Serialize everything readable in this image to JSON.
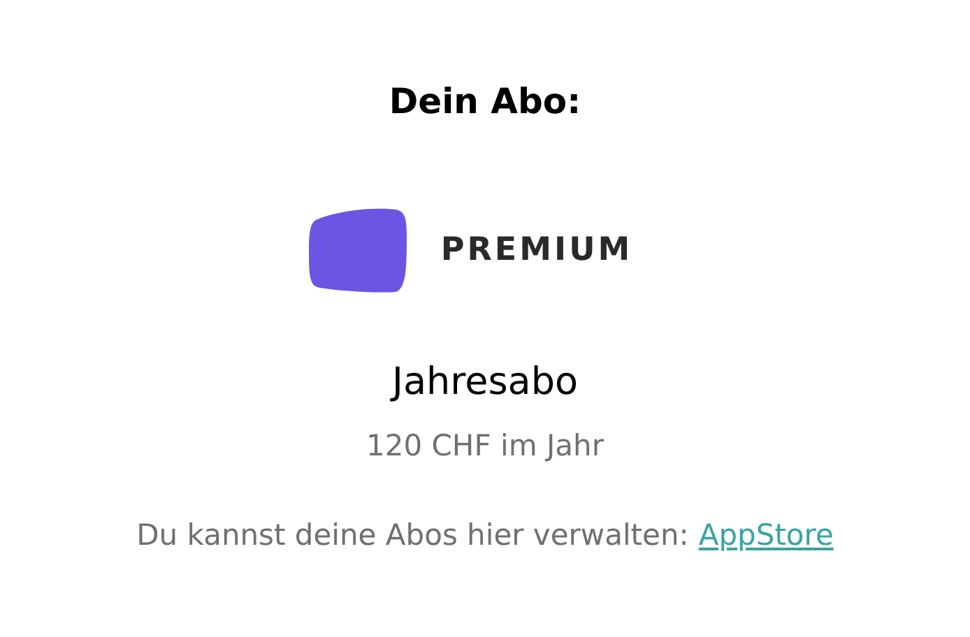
{
  "heading": "Dein Abo:",
  "plan": {
    "badge": "PREMIUM",
    "name": "Jahresabo",
    "price": "120 CHF im Jahr"
  },
  "footer": {
    "text": "Du kannst deine Abos hier verwalten:",
    "link": "AppStore"
  }
}
